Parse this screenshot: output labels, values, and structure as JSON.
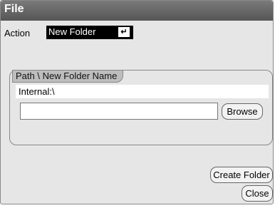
{
  "window": {
    "title": "File"
  },
  "action": {
    "label": "Action",
    "selected": "New Folder",
    "enter_glyph": "↵"
  },
  "path_group": {
    "title": "Path \\ New Folder Name",
    "path": "Internal:\\",
    "name_value": "",
    "browse_label": "Browse"
  },
  "buttons": {
    "create_folder": "Create Folder",
    "close": "Close"
  }
}
